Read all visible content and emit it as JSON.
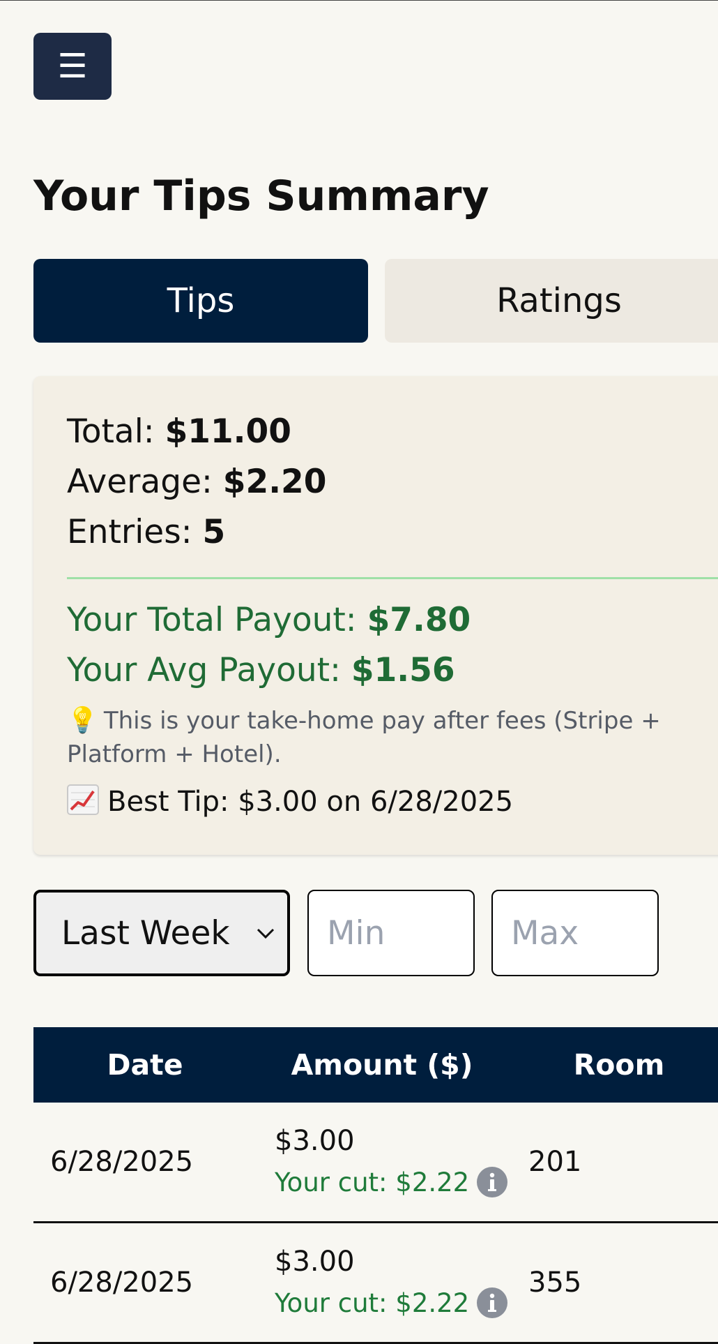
{
  "header": {
    "menu_glyph": "☰",
    "title": "Your Tips Summary"
  },
  "tabs": [
    {
      "label": "Tips",
      "active": true
    },
    {
      "label": "Ratings",
      "active": false
    }
  ],
  "summary": {
    "total_label": "Total:",
    "total_value": "$11.00",
    "average_label": "Average:",
    "average_value": "$2.20",
    "entries_label": "Entries:",
    "entries_value": "5",
    "total_payout_label": "Your Total Payout:",
    "total_payout_value": "$7.80",
    "avg_payout_label": "Your Avg Payout:",
    "avg_payout_value": "$1.56",
    "note_icon": "💡",
    "note": "This is your take-home pay after fees (Stripe + Platform + Hotel).",
    "best_tip": "Best Tip: $3.00 on 6/28/2025"
  },
  "filters": {
    "period_selected": "Last Week",
    "min_placeholder": "Min",
    "max_placeholder": "Max"
  },
  "table": {
    "headers": [
      "Date",
      "Amount ($)",
      "Room"
    ],
    "rows": [
      {
        "date": "6/28/2025",
        "amount": "$3.00",
        "cut": "Your cut: $2.22",
        "room": "201"
      },
      {
        "date": "6/28/2025",
        "amount": "$3.00",
        "cut": "Your cut: $2.22",
        "room": "355"
      }
    ]
  },
  "colors": {
    "navy": "#001e3d",
    "menu_button": "#1e2b45",
    "payout_green": "#1f6b35",
    "card_bg": "#f3efe5",
    "page_bg": "#f8f7f2"
  },
  "icons": [
    "menu-icon",
    "lightbulb-icon",
    "chart-increasing-icon",
    "chevron-down-icon",
    "info-icon"
  ]
}
